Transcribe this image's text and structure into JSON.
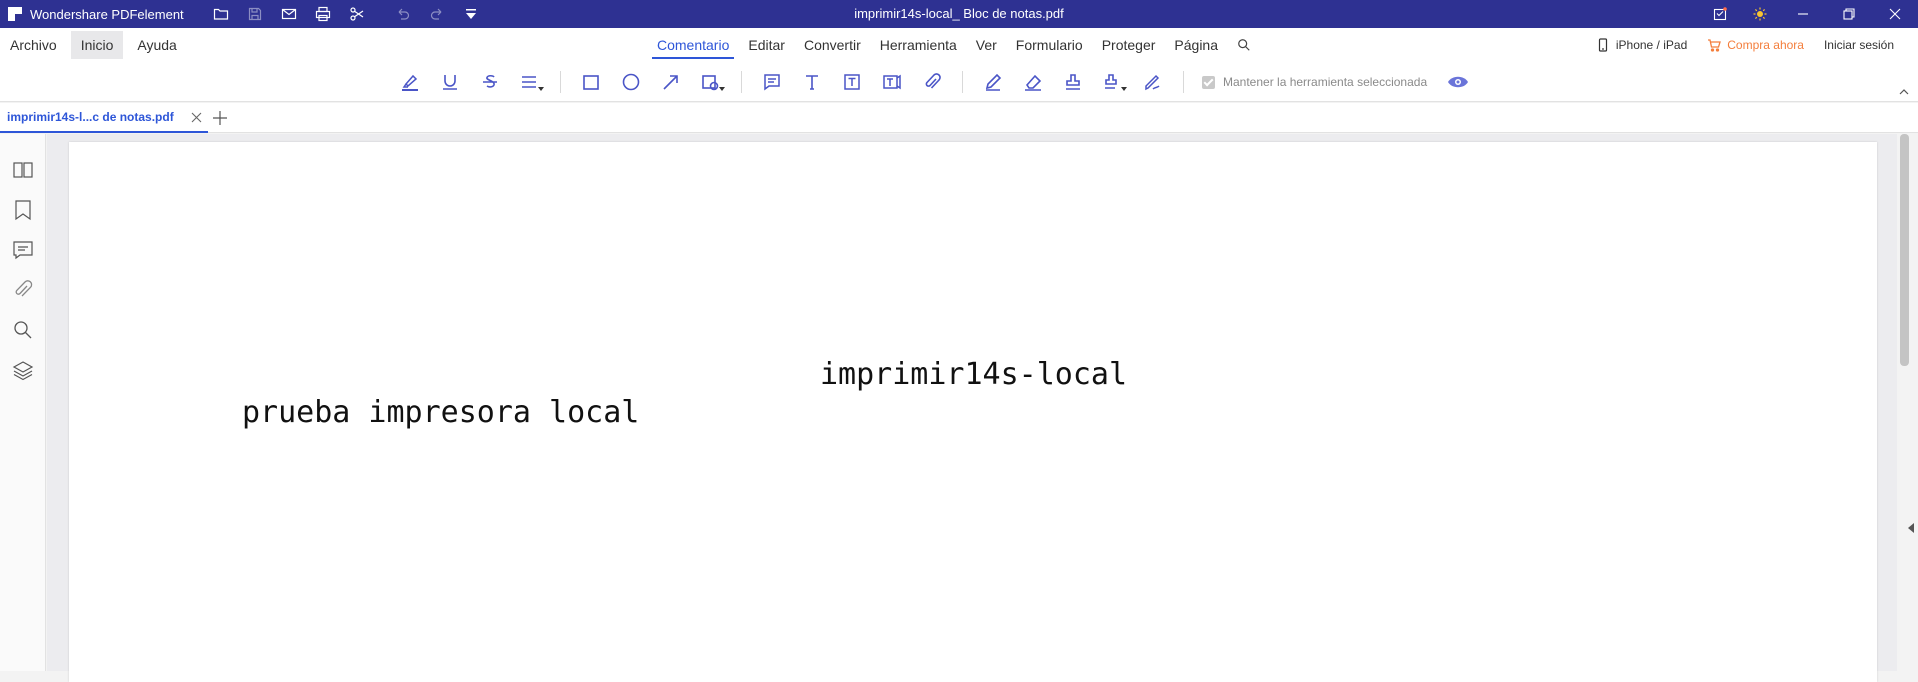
{
  "titlebar": {
    "app_name": "Wondershare PDFelement",
    "document_title": "imprimir14s-local_ Bloc de notas.pdf",
    "icons": [
      "folder-icon",
      "save-icon",
      "mail-icon",
      "print-icon",
      "cut-icon",
      "undo-icon",
      "redo-icon",
      "customize-icon"
    ],
    "window_icons": [
      "notification-icon",
      "theme-icon",
      "minimize-icon",
      "maximize-icon",
      "close-icon"
    ]
  },
  "menu": {
    "left": [
      "Archivo",
      "Inicio",
      "Ayuda"
    ],
    "active_left": "Inicio",
    "center": [
      "Comentario",
      "Editar",
      "Convertir",
      "Herramienta",
      "Ver",
      "Formulario",
      "Proteger",
      "Página"
    ],
    "active_center": "Comentario",
    "iphone_label": "iPhone / iPad",
    "buy_label": "Compra ahora",
    "signin_label": "Iniciar sesión"
  },
  "toolbar": {
    "keep_tool_label": "Mantener la herramienta seleccionada",
    "keep_tool_checked": true,
    "accent_color": "#4a55c7"
  },
  "tabs": {
    "active_tab_label": "imprimir14s-l...c de notas.pdf"
  },
  "document": {
    "line1": "imprimir14s-local",
    "line2": "prueba impresora local"
  },
  "colors": {
    "titlebar_bg": "#2e3192",
    "active_menu": "#2e56d8",
    "buy_orange": "#f47e3c"
  }
}
